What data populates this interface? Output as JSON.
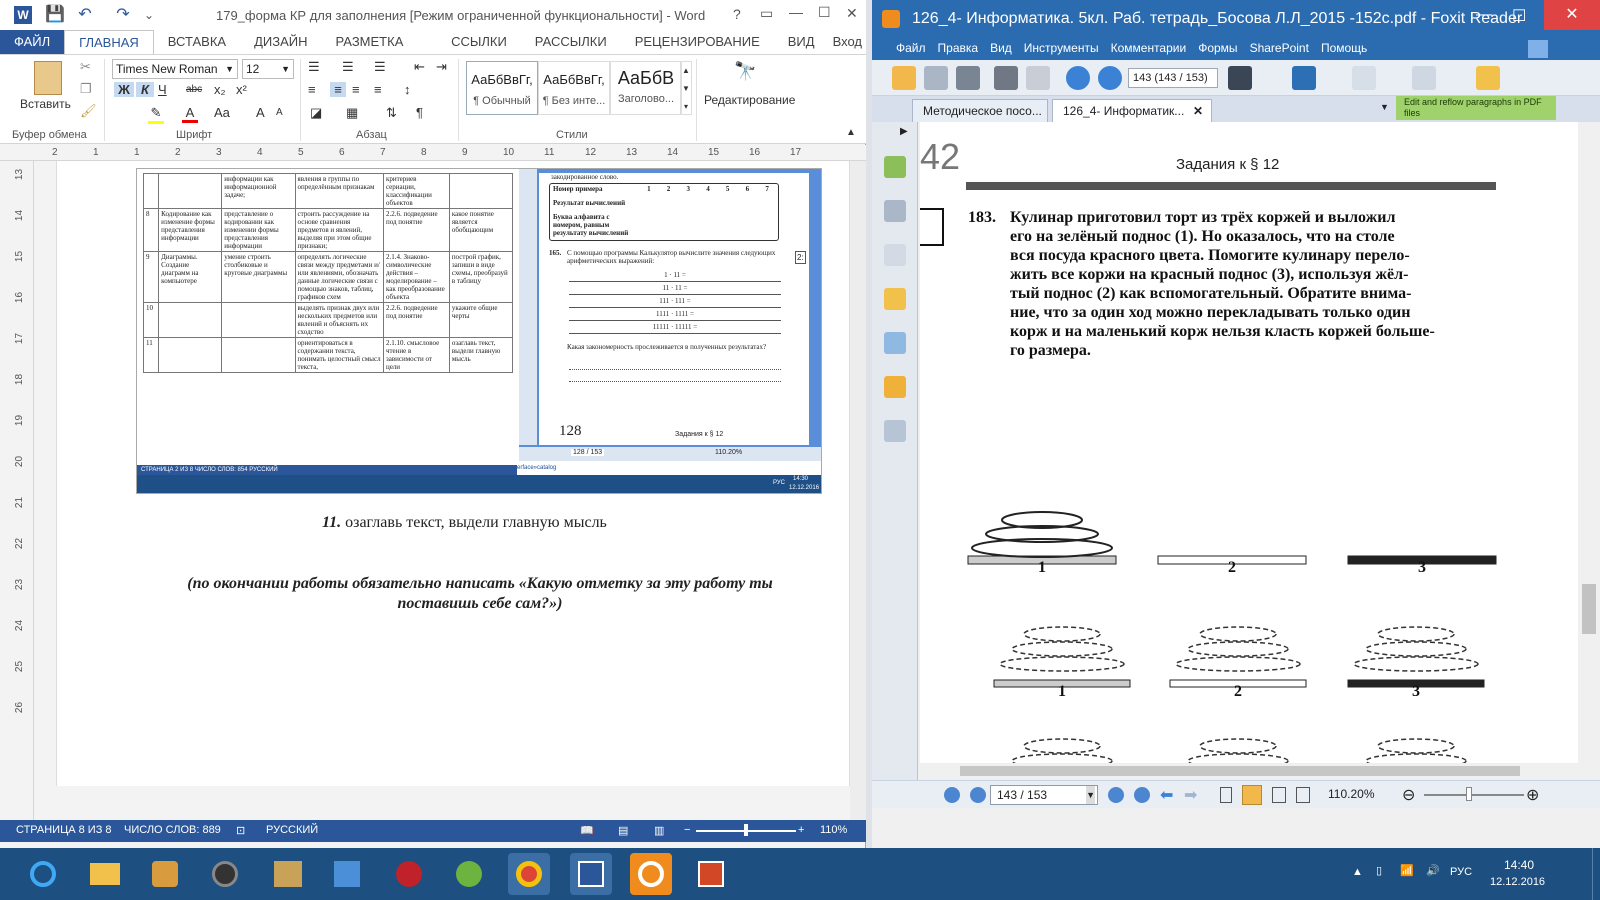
{
  "word": {
    "title": "179_форма КР для заполнения [Режим ограниченной функциональности] - Word",
    "quick_access": [
      "W",
      "💾",
      "↶",
      "↷",
      "⌄"
    ],
    "window_controls": [
      "?",
      "▭",
      "—",
      "☐",
      "✕"
    ],
    "tabs": [
      "ФАЙЛ",
      "ГЛАВНАЯ",
      "ВСТАВКА",
      "ДИЗАЙН",
      "РАЗМЕТКА СТРАНИЦЫ",
      "ССЫЛКИ",
      "РАССЫЛКИ",
      "РЕЦЕНЗИРОВАНИЕ",
      "ВИД",
      "Вход"
    ],
    "ribbon": {
      "paste": "Вставить",
      "font_name": "Times New Roman",
      "font_size": "12",
      "font_buttons": [
        "Ж",
        "К",
        "Ч",
        "abc",
        "x₂",
        "x²"
      ],
      "styles": [
        {
          "sample": "АаБбВвГг,",
          "name": "¶ Обычный"
        },
        {
          "sample": "АаБбВвГг,",
          "name": "¶ Без инте..."
        },
        {
          "sample": "АаБбВ",
          "name": "Заголово..."
        }
      ],
      "editing": "Редактирование",
      "groups": [
        "Буфер обмена",
        "Шрифт",
        "Абзац",
        "Стили"
      ]
    },
    "ruler_marks": [
      "2",
      "1",
      "1",
      "2",
      "3",
      "4",
      "5",
      "6",
      "7",
      "8",
      "9",
      "10",
      "11",
      "12",
      "13",
      "14",
      "15",
      "16",
      "17"
    ],
    "vruler_marks": [
      "13",
      "14",
      "15",
      "16",
      "17",
      "18",
      "19",
      "20",
      "21",
      "22",
      "23",
      "24",
      "25",
      "26"
    ],
    "embedded": {
      "rows": [
        [
          "",
          "",
          "информации как информационной задаче;",
          "явления в группы по определённым признакам",
          "критериев сериации, классификации объектов",
          ""
        ],
        [
          "8",
          "Кодирование как изменение формы представления информации",
          "представление о кодировании как изменении формы представления информации",
          "строить рассуждение на основе сравнения предметов и явлений, выделяя при этом общие признаки;",
          "2.2.6. подведение под понятие",
          "какое понятие является обобщающим"
        ],
        [
          "9",
          "Диаграммы. Создание диаграмм на компьютере",
          "умение строить столбиковые и круговые диаграммы",
          "определять логические связи между предметами и/или явлениями, обозначать данные логические связи с помощью знаков, таблиц, графиков схем",
          "2.1.4. Знаково-символические действия – моделирование – как преобразование объекта",
          "построй график, запиши в виде схемы, преобразуй в таблицу"
        ],
        [
          "10",
          "",
          "",
          "выделять признак двух или нескольких предметов или явлений и объяснять их сходство",
          "2.2.6. подведение под понятие",
          "укажите общие черты"
        ],
        [
          "11",
          "",
          "",
          "ориентироваться в содержании текста, понимать целостный смысл текста,",
          "2.1.10. смысловое чтение в зависимости от цели",
          "озаглавь текст, выдели главную мысль"
        ]
      ],
      "pdf_header": "закодированное слово.",
      "pdf_table_label1": "Номер примера",
      "pdf_table_label2": "Результат вычислений",
      "pdf_table_label3": "Буква алфавита с номером, равным результату вычислений",
      "pdf_cols": [
        "1",
        "2",
        "3",
        "4",
        "5",
        "6",
        "7"
      ],
      "pdf_task_num": "165.",
      "pdf_task": "С помощью программы Калькулятор вычислите значения следующих арифметических выражений:",
      "pdf_exprs": [
        "1 · 11 =",
        "11 · 11 =",
        "111 · 111 =",
        "1111 · 1111 =",
        "11111 · 11111 ="
      ],
      "pdf_question": "Какая закономерность прослеживается в полученных результатах?",
      "pdf_page_num": "128",
      "pdf_page_title": "Задания к § 12",
      "pdf_nav": "128 / 153",
      "pdf_zoom": "110.20%",
      "status": "СТРАНИЦА 2 ИЗ 8   ЧИСЛО СЛОВ: 854   РУССКИЙ",
      "url_fragment": "erface»catalog",
      "clock": "14:30",
      "date": "12.12.2016",
      "lang": "РУС",
      "side_num": "2:"
    },
    "task_11_num": "11.",
    "task_11_text": "озаглавь текст, выдели главную мысль",
    "closing_note": "(по окончании работы обязательно написать «Какую отметку за эту работу ты поставишь себе сам?»)",
    "status": {
      "page": "СТРАНИЦА 8 ИЗ 8",
      "words": "ЧИСЛО СЛОВ: 889",
      "lang": "РУССКИЙ",
      "zoom": "110%"
    }
  },
  "foxit": {
    "title": "126_4- Информатика. 5кл. Раб. тетрадь_Босова Л.Л_2015 -152с.pdf - Foxit Reader",
    "menu": [
      "Файл",
      "Правка",
      "Вид",
      "Инструменты",
      "Комментарии",
      "Формы",
      "SharePoint",
      "Помощь"
    ],
    "toolbar_page": "143 (143 / 153)",
    "tabs": [
      "Методическое посо...",
      "126_4- Информатик..."
    ],
    "banner": "Edit and reflow paragraphs in PDF files",
    "page_number": "42",
    "page_title": "Задания к § 12",
    "task_number": "183.",
    "task_lines": [
      "Кулинар приготовил торт из трёх коржей и выложил",
      "его на зелёный поднос (1). Но оказалось, что на столе",
      "вся посуда красного цвета. Помогите кулинару перело-",
      "жить все коржи на красный поднос (3), используя жёл-",
      "тый поднос (2) как вспомогательный. Обратите внима-",
      "ние, что за один ход можно перекладывать только один",
      "корж и на маленький корж нельзя класть коржей больше-",
      "го размера."
    ],
    "tray_labels": [
      "1",
      "2",
      "3"
    ],
    "nav_page": "143 / 153",
    "zoom": "110.20%"
  },
  "taskbar": {
    "lang": "РУС",
    "time": "14:40",
    "date": "12.12.2016"
  }
}
